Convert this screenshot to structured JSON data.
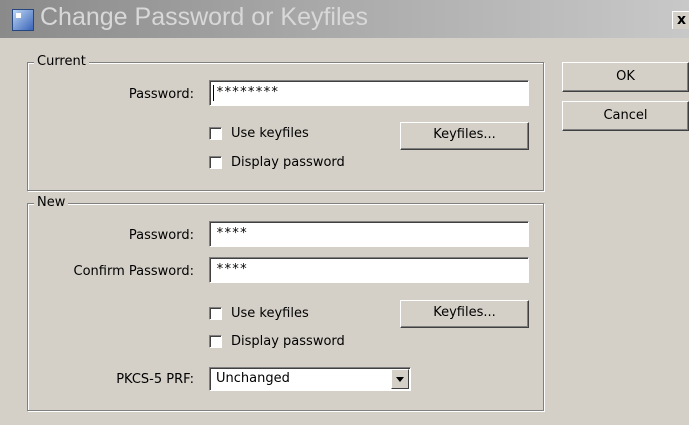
{
  "window": {
    "title": "Change Password or Keyfiles",
    "close_symbol": "x"
  },
  "current": {
    "legend": "Current",
    "password_label": "Password:",
    "password_value": "********",
    "use_keyfiles": "Use keyfiles",
    "keyfiles_button": "Keyfiles...",
    "display_password": "Display password"
  },
  "new": {
    "legend": "New",
    "password_label": "Password:",
    "password_value": "****",
    "confirm_label": "Confirm Password:",
    "confirm_value": "****",
    "use_keyfiles": "Use keyfiles",
    "keyfiles_button": "Keyfiles...",
    "display_password": "Display password",
    "prf_label": "PKCS-5 PRF:",
    "prf_value": "Unchanged"
  },
  "buttons": {
    "ok": "OK",
    "cancel": "Cancel"
  }
}
